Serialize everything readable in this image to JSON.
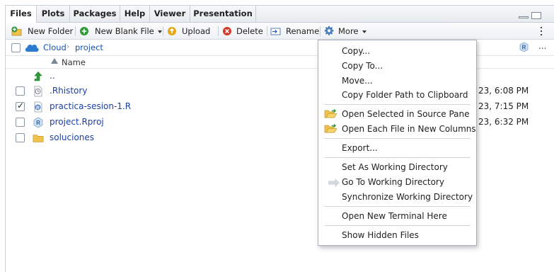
{
  "tabs": [
    {
      "label": "Files",
      "active": true
    },
    {
      "label": "Plots"
    },
    {
      "label": "Packages"
    },
    {
      "label": "Help"
    },
    {
      "label": "Viewer"
    },
    {
      "label": "Presentation"
    }
  ],
  "toolbar": {
    "new_folder": "New Folder",
    "new_blank_file": "New Blank File",
    "upload": "Upload",
    "delete": "Delete",
    "rename": "Rename",
    "more": "More"
  },
  "path": {
    "cloud": "Cloud",
    "project": "project",
    "more": "..."
  },
  "header": {
    "name": "Name"
  },
  "files": [
    {
      "name": "..",
      "icon": "up-arrow-icon",
      "checked": false,
      "date": ""
    },
    {
      "name": ".Rhistory",
      "icon": "history-file-icon",
      "checked": false,
      "date": "23, 6:08 PM"
    },
    {
      "name": "practica-sesion-1.R",
      "icon": "r-script-icon",
      "checked": true,
      "date": "23, 7:15 PM"
    },
    {
      "name": "project.Rproj",
      "icon": "rproj-icon",
      "checked": false,
      "date": "23, 6:32 PM"
    },
    {
      "name": "soluciones",
      "icon": "folder-icon",
      "checked": false,
      "date": ""
    }
  ],
  "menu": {
    "items": [
      "Copy...",
      "Copy To...",
      "Move...",
      "Copy Folder Path to Clipboard",
      "Open Selected in Source Pane",
      "Open Each File in New Columns",
      "Export...",
      "Set As Working Directory",
      "Go To Working Directory",
      "Synchronize Working Directory",
      "Open New Terminal Here",
      "Show Hidden Files"
    ]
  },
  "colors": {
    "link": "#1a3fa8",
    "accent_green": "#2e9a3a",
    "delete_red": "#d23a2a",
    "folder": "#f0c24c"
  }
}
